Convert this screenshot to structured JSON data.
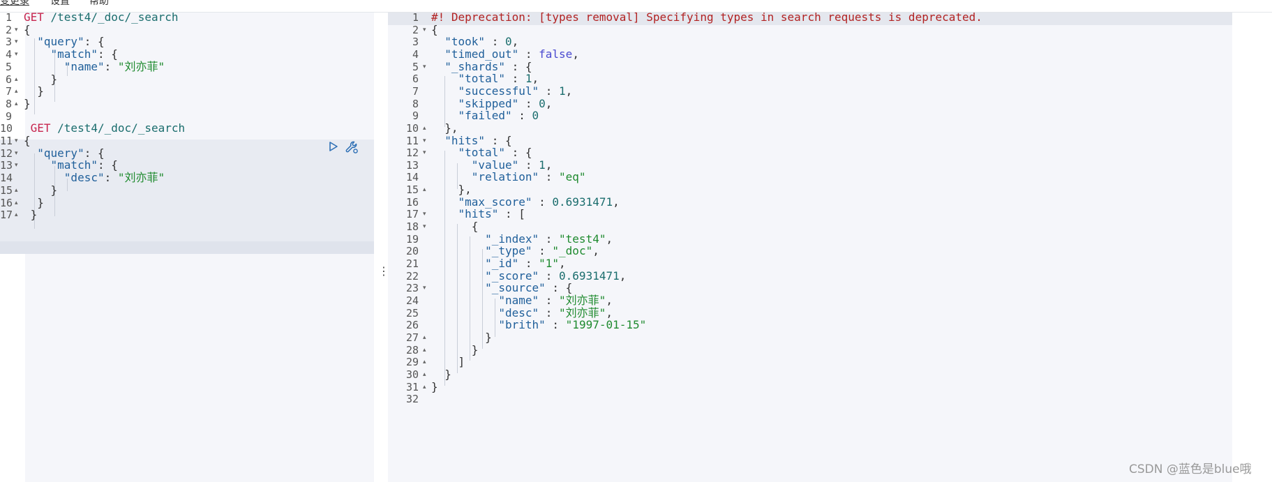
{
  "menu": [
    "变更录",
    "设置",
    "帮助"
  ],
  "request": {
    "lines": [
      {
        "n": "1",
        "fold": "",
        "segs": [
          {
            "c": "k-method",
            "t": "GET"
          },
          {
            "c": "k-path",
            "t": " /test4/_doc/_search"
          }
        ]
      },
      {
        "n": "2",
        "fold": "▾",
        "segs": [
          {
            "c": "k-punc",
            "t": "{"
          }
        ]
      },
      {
        "n": "3",
        "fold": "▾",
        "segs": [
          {
            "c": "k-punc",
            "t": "  "
          },
          {
            "c": "k-key",
            "t": "\"query\""
          },
          {
            "c": "k-punc",
            "t": ": {"
          }
        ]
      },
      {
        "n": "4",
        "fold": "▾",
        "segs": [
          {
            "c": "k-punc",
            "t": "    "
          },
          {
            "c": "k-key",
            "t": "\"match\""
          },
          {
            "c": "k-punc",
            "t": ": {"
          }
        ]
      },
      {
        "n": "5",
        "fold": "",
        "segs": [
          {
            "c": "k-punc",
            "t": "      "
          },
          {
            "c": "k-key",
            "t": "\"name\""
          },
          {
            "c": "k-punc",
            "t": ": "
          },
          {
            "c": "k-str",
            "t": "\"刘亦菲\""
          }
        ]
      },
      {
        "n": "6",
        "fold": "▴",
        "segs": [
          {
            "c": "k-punc",
            "t": "    }"
          }
        ]
      },
      {
        "n": "7",
        "fold": "▴",
        "segs": [
          {
            "c": "k-punc",
            "t": "  }"
          }
        ]
      },
      {
        "n": "8",
        "fold": "▴",
        "segs": [
          {
            "c": "k-punc",
            "t": "}"
          }
        ]
      },
      {
        "n": "9",
        "fold": "",
        "segs": []
      },
      {
        "n": "10",
        "fold": "",
        "segs": [
          {
            "c": "k-method",
            "t": " GET"
          },
          {
            "c": "k-path",
            "t": " /test4/_doc/_search"
          }
        ]
      },
      {
        "n": "11",
        "fold": "▾",
        "segs": [
          {
            "c": "k-punc",
            "t": "{"
          }
        ]
      },
      {
        "n": "12",
        "fold": "▾",
        "segs": [
          {
            "c": "k-punc",
            "t": "  "
          },
          {
            "c": "k-key",
            "t": "\"query\""
          },
          {
            "c": "k-punc",
            "t": ": {"
          }
        ]
      },
      {
        "n": "13",
        "fold": "▾",
        "segs": [
          {
            "c": "k-punc",
            "t": "    "
          },
          {
            "c": "k-key",
            "t": "\"match\""
          },
          {
            "c": "k-punc",
            "t": ": {"
          }
        ]
      },
      {
        "n": "14",
        "fold": "",
        "segs": [
          {
            "c": "k-punc",
            "t": "      "
          },
          {
            "c": "k-key",
            "t": "\"desc\""
          },
          {
            "c": "k-punc",
            "t": ": "
          },
          {
            "c": "k-str",
            "t": "\"刘亦菲\""
          }
        ]
      },
      {
        "n": "15",
        "fold": "▴",
        "segs": [
          {
            "c": "k-punc",
            "t": "    }"
          }
        ]
      },
      {
        "n": "16",
        "fold": "▴",
        "segs": [
          {
            "c": "k-punc",
            "t": "  }"
          }
        ]
      },
      {
        "n": "17",
        "fold": "▴",
        "segs": [
          {
            "c": "k-punc",
            "t": " }"
          }
        ]
      }
    ]
  },
  "response": {
    "lines": [
      {
        "n": "1",
        "fold": "",
        "segs": [
          {
            "c": "k-warn",
            "t": "#! Deprecation: [types removal] Specifying types in search requests is deprecated."
          }
        ]
      },
      {
        "n": "2",
        "fold": "▾",
        "segs": [
          {
            "c": "k-punc",
            "t": "{"
          }
        ]
      },
      {
        "n": "3",
        "fold": "",
        "segs": [
          {
            "c": "k-punc",
            "t": "  "
          },
          {
            "c": "k-key",
            "t": "\"took\""
          },
          {
            "c": "k-punc",
            "t": " : "
          },
          {
            "c": "k-num",
            "t": "0"
          },
          {
            "c": "k-punc",
            "t": ","
          }
        ]
      },
      {
        "n": "4",
        "fold": "",
        "segs": [
          {
            "c": "k-punc",
            "t": "  "
          },
          {
            "c": "k-key",
            "t": "\"timed_out\""
          },
          {
            "c": "k-punc",
            "t": " : "
          },
          {
            "c": "k-bool",
            "t": "false"
          },
          {
            "c": "k-punc",
            "t": ","
          }
        ]
      },
      {
        "n": "5",
        "fold": "▾",
        "segs": [
          {
            "c": "k-punc",
            "t": "  "
          },
          {
            "c": "k-key",
            "t": "\"_shards\""
          },
          {
            "c": "k-punc",
            "t": " : {"
          }
        ]
      },
      {
        "n": "6",
        "fold": "",
        "segs": [
          {
            "c": "k-punc",
            "t": "    "
          },
          {
            "c": "k-key",
            "t": "\"total\""
          },
          {
            "c": "k-punc",
            "t": " : "
          },
          {
            "c": "k-num",
            "t": "1"
          },
          {
            "c": "k-punc",
            "t": ","
          }
        ]
      },
      {
        "n": "7",
        "fold": "",
        "segs": [
          {
            "c": "k-punc",
            "t": "    "
          },
          {
            "c": "k-key",
            "t": "\"successful\""
          },
          {
            "c": "k-punc",
            "t": " : "
          },
          {
            "c": "k-num",
            "t": "1"
          },
          {
            "c": "k-punc",
            "t": ","
          }
        ]
      },
      {
        "n": "8",
        "fold": "",
        "segs": [
          {
            "c": "k-punc",
            "t": "    "
          },
          {
            "c": "k-key",
            "t": "\"skipped\""
          },
          {
            "c": "k-punc",
            "t": " : "
          },
          {
            "c": "k-num",
            "t": "0"
          },
          {
            "c": "k-punc",
            "t": ","
          }
        ]
      },
      {
        "n": "9",
        "fold": "",
        "segs": [
          {
            "c": "k-punc",
            "t": "    "
          },
          {
            "c": "k-key",
            "t": "\"failed\""
          },
          {
            "c": "k-punc",
            "t": " : "
          },
          {
            "c": "k-num",
            "t": "0"
          }
        ]
      },
      {
        "n": "10",
        "fold": "▴",
        "segs": [
          {
            "c": "k-punc",
            "t": "  },"
          }
        ]
      },
      {
        "n": "11",
        "fold": "▾",
        "segs": [
          {
            "c": "k-punc",
            "t": "  "
          },
          {
            "c": "k-key",
            "t": "\"hits\""
          },
          {
            "c": "k-punc",
            "t": " : {"
          }
        ]
      },
      {
        "n": "12",
        "fold": "▾",
        "segs": [
          {
            "c": "k-punc",
            "t": "    "
          },
          {
            "c": "k-key",
            "t": "\"total\""
          },
          {
            "c": "k-punc",
            "t": " : {"
          }
        ]
      },
      {
        "n": "13",
        "fold": "",
        "segs": [
          {
            "c": "k-punc",
            "t": "      "
          },
          {
            "c": "k-key",
            "t": "\"value\""
          },
          {
            "c": "k-punc",
            "t": " : "
          },
          {
            "c": "k-num",
            "t": "1"
          },
          {
            "c": "k-punc",
            "t": ","
          }
        ]
      },
      {
        "n": "14",
        "fold": "",
        "segs": [
          {
            "c": "k-punc",
            "t": "      "
          },
          {
            "c": "k-key",
            "t": "\"relation\""
          },
          {
            "c": "k-punc",
            "t": " : "
          },
          {
            "c": "k-str",
            "t": "\"eq\""
          }
        ]
      },
      {
        "n": "15",
        "fold": "▴",
        "segs": [
          {
            "c": "k-punc",
            "t": "    },"
          }
        ]
      },
      {
        "n": "16",
        "fold": "",
        "segs": [
          {
            "c": "k-punc",
            "t": "    "
          },
          {
            "c": "k-key",
            "t": "\"max_score\""
          },
          {
            "c": "k-punc",
            "t": " : "
          },
          {
            "c": "k-num",
            "t": "0.6931471"
          },
          {
            "c": "k-punc",
            "t": ","
          }
        ]
      },
      {
        "n": "17",
        "fold": "▾",
        "segs": [
          {
            "c": "k-punc",
            "t": "    "
          },
          {
            "c": "k-key",
            "t": "\"hits\""
          },
          {
            "c": "k-punc",
            "t": " : ["
          }
        ]
      },
      {
        "n": "18",
        "fold": "▾",
        "segs": [
          {
            "c": "k-punc",
            "t": "      {"
          }
        ]
      },
      {
        "n": "19",
        "fold": "",
        "segs": [
          {
            "c": "k-punc",
            "t": "        "
          },
          {
            "c": "k-key",
            "t": "\"_index\""
          },
          {
            "c": "k-punc",
            "t": " : "
          },
          {
            "c": "k-str",
            "t": "\"test4\""
          },
          {
            "c": "k-punc",
            "t": ","
          }
        ]
      },
      {
        "n": "20",
        "fold": "",
        "segs": [
          {
            "c": "k-punc",
            "t": "        "
          },
          {
            "c": "k-key",
            "t": "\"_type\""
          },
          {
            "c": "k-punc",
            "t": " : "
          },
          {
            "c": "k-str",
            "t": "\"_doc\""
          },
          {
            "c": "k-punc",
            "t": ","
          }
        ]
      },
      {
        "n": "21",
        "fold": "",
        "segs": [
          {
            "c": "k-punc",
            "t": "        "
          },
          {
            "c": "k-key",
            "t": "\"_id\""
          },
          {
            "c": "k-punc",
            "t": " : "
          },
          {
            "c": "k-str",
            "t": "\"1\""
          },
          {
            "c": "k-punc",
            "t": ","
          }
        ]
      },
      {
        "n": "22",
        "fold": "",
        "segs": [
          {
            "c": "k-punc",
            "t": "        "
          },
          {
            "c": "k-key",
            "t": "\"_score\""
          },
          {
            "c": "k-punc",
            "t": " : "
          },
          {
            "c": "k-num",
            "t": "0.6931471"
          },
          {
            "c": "k-punc",
            "t": ","
          }
        ]
      },
      {
        "n": "23",
        "fold": "▾",
        "segs": [
          {
            "c": "k-punc",
            "t": "        "
          },
          {
            "c": "k-key",
            "t": "\"_source\""
          },
          {
            "c": "k-punc",
            "t": " : {"
          }
        ]
      },
      {
        "n": "24",
        "fold": "",
        "segs": [
          {
            "c": "k-punc",
            "t": "          "
          },
          {
            "c": "k-key",
            "t": "\"name\""
          },
          {
            "c": "k-punc",
            "t": " : "
          },
          {
            "c": "k-str",
            "t": "\"刘亦菲\""
          },
          {
            "c": "k-punc",
            "t": ","
          }
        ]
      },
      {
        "n": "25",
        "fold": "",
        "segs": [
          {
            "c": "k-punc",
            "t": "          "
          },
          {
            "c": "k-key",
            "t": "\"desc\""
          },
          {
            "c": "k-punc",
            "t": " : "
          },
          {
            "c": "k-str",
            "t": "\"刘亦菲\""
          },
          {
            "c": "k-punc",
            "t": ","
          }
        ]
      },
      {
        "n": "26",
        "fold": "",
        "segs": [
          {
            "c": "k-punc",
            "t": "          "
          },
          {
            "c": "k-key",
            "t": "\"brith\""
          },
          {
            "c": "k-punc",
            "t": " : "
          },
          {
            "c": "k-str",
            "t": "\"1997-01-15\""
          }
        ]
      },
      {
        "n": "27",
        "fold": "▴",
        "segs": [
          {
            "c": "k-punc",
            "t": "        }"
          }
        ]
      },
      {
        "n": "28",
        "fold": "▴",
        "segs": [
          {
            "c": "k-punc",
            "t": "      }"
          }
        ]
      },
      {
        "n": "29",
        "fold": "▴",
        "segs": [
          {
            "c": "k-punc",
            "t": "    ]"
          }
        ]
      },
      {
        "n": "30",
        "fold": "▴",
        "segs": [
          {
            "c": "k-punc",
            "t": "  }"
          }
        ]
      },
      {
        "n": "31",
        "fold": "▴",
        "segs": [
          {
            "c": "k-punc",
            "t": "}"
          }
        ]
      },
      {
        "n": "32",
        "fold": "",
        "segs": []
      }
    ]
  },
  "icons": {
    "run": "play-icon",
    "settings": "wrench-icon",
    "splitter": "vertical-ellipsis-icon"
  },
  "splitter_glyph": "⋮",
  "watermark": "CSDN @蓝色是blue哦",
  "colors": {
    "method": "#c7254e",
    "key": "#1f5f9a",
    "string": "#1e8a2e",
    "number": "#1a6d6d",
    "warning": "#b22222",
    "boolean": "#4a4ad0"
  }
}
